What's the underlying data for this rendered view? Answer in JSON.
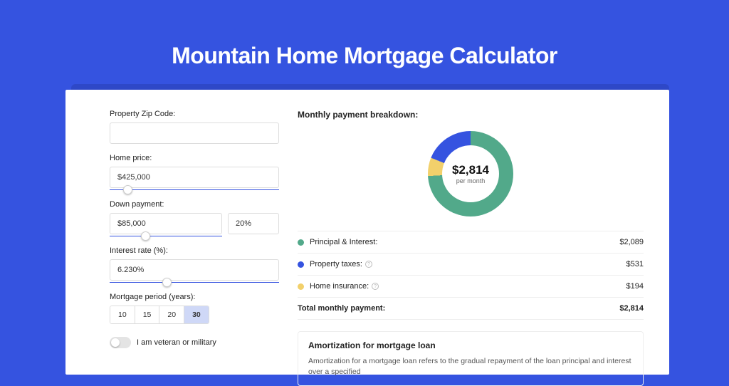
{
  "title": "Mountain Home Mortgage Calculator",
  "form": {
    "zip_label": "Property Zip Code:",
    "zip_value": "",
    "price_label": "Home price:",
    "price_value": "$425,000",
    "down_label": "Down payment:",
    "down_value": "$85,000",
    "down_pct": "20%",
    "rate_label": "Interest rate (%):",
    "rate_value": "6.230%",
    "period_label": "Mortgage period (years):",
    "periods": [
      "10",
      "15",
      "20",
      "30"
    ],
    "period_active": "30",
    "veteran_label": "I am veteran or military"
  },
  "breakdown": {
    "title": "Monthly payment breakdown:",
    "center_value": "$2,814",
    "center_sub": "per month",
    "items": [
      {
        "label": "Principal & Interest:",
        "value": "$2,089",
        "color": "#52a98a",
        "info": false
      },
      {
        "label": "Property taxes:",
        "value": "$531",
        "color": "#3553e0",
        "info": true
      },
      {
        "label": "Home insurance:",
        "value": "$194",
        "color": "#f2d06b",
        "info": true
      }
    ],
    "total_label": "Total monthly payment:",
    "total_value": "$2,814"
  },
  "amort": {
    "title": "Amortization for mortgage loan",
    "text": "Amortization for a mortgage loan refers to the gradual repayment of the loan principal and interest over a specified"
  },
  "chart_data": {
    "type": "pie",
    "title": "Monthly payment breakdown",
    "series": [
      {
        "name": "Principal & Interest",
        "value": 2089,
        "color": "#52a98a"
      },
      {
        "name": "Property taxes",
        "value": 531,
        "color": "#3553e0"
      },
      {
        "name": "Home insurance",
        "value": 194,
        "color": "#f2d06b"
      }
    ],
    "total": 2814,
    "center_label": "$2,814 per month"
  }
}
